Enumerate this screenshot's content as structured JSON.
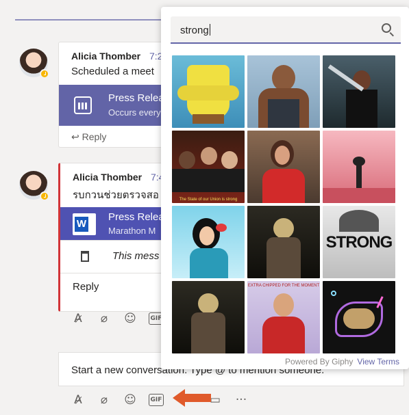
{
  "messages": [
    {
      "sender": "Alicia Thomber",
      "time": "7:2",
      "text": "Scheduled a meet",
      "card": {
        "title": "Press Relea",
        "subtitle": "Occurs every"
      },
      "reply_label": "Reply"
    },
    {
      "sender": "Alicia Thomber",
      "time": "7:4",
      "text": "รบกวนช่วยตรวจสอ",
      "card": {
        "icon_letter": "W",
        "title": "Press Relea",
        "subtitle": "Marathon M"
      },
      "deleted_text": "This mess",
      "reply_label": "Reply"
    }
  ],
  "compose": {
    "placeholder": "Start a new conversation. Type @ to mention someone."
  },
  "gif_picker": {
    "search_value": "strong",
    "footer": {
      "powered_by": "Powered By Giphy",
      "view_terms": "View Terms"
    },
    "gifs": [
      {
        "name": "gif-spongebob-muscles",
        "caption": ""
      },
      {
        "name": "gif-flexing-man",
        "caption": ""
      },
      {
        "name": "gif-woman-lifting",
        "caption": ""
      },
      {
        "name": "gif-obama-group",
        "caption": "The State of our Union is strong"
      },
      {
        "name": "gif-woman-cheering",
        "caption": ""
      },
      {
        "name": "gif-silhouette-pink",
        "caption": ""
      },
      {
        "name": "gif-cartoon-woman-flex",
        "caption": ""
      },
      {
        "name": "gif-dark-figure",
        "caption": ""
      },
      {
        "name": "gif-strong-text",
        "caption": "STRONG"
      },
      {
        "name": "gif-dark-figure-2",
        "caption": ""
      },
      {
        "name": "gif-woman-red-flex",
        "caption": "EXTRA CHIPPED FOR THE MOMENT"
      },
      {
        "name": "gif-neon-arm",
        "caption": ""
      }
    ]
  },
  "toolbar_labels": {
    "gif": "GIF",
    "more": "···"
  },
  "colors": {
    "accent": "#6264a7",
    "presence_away": "#f8b600",
    "word_blue": "#185abd",
    "arrow": "#e05a2b"
  }
}
